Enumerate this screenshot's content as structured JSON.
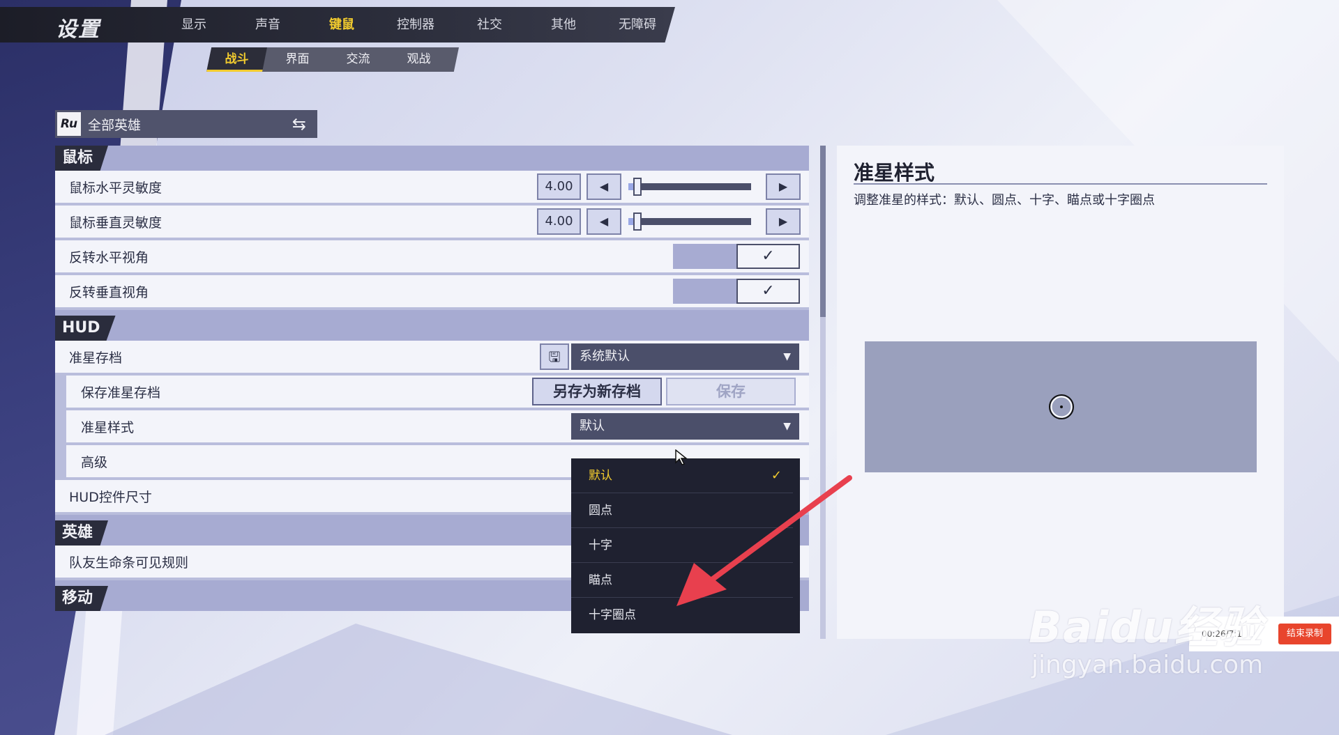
{
  "header": {
    "title": "设置",
    "tabs": [
      {
        "label": "显示"
      },
      {
        "label": "声音"
      },
      {
        "label": "键鼠",
        "active": true
      },
      {
        "label": "控制器"
      },
      {
        "label": "社交"
      },
      {
        "label": "其他"
      },
      {
        "label": "无障碍"
      }
    ]
  },
  "subtabs": [
    {
      "label": "战斗",
      "active": true
    },
    {
      "label": "界面"
    },
    {
      "label": "交流"
    },
    {
      "label": "观战"
    }
  ],
  "hero_selector": {
    "label": "全部英雄",
    "logo_text": "Ru",
    "swap_icon": "⇆"
  },
  "sections": {
    "mouse": {
      "title": "鼠标",
      "h_sensitivity": {
        "label": "鼠标水平灵敏度",
        "value": "4.00",
        "level": 0.04
      },
      "v_sensitivity": {
        "label": "鼠标垂直灵敏度",
        "value": "4.00",
        "level": 0.04
      },
      "invert_h": {
        "label": "反转水平视角",
        "checked": true
      },
      "invert_v": {
        "label": "反转垂直视角",
        "checked": true
      }
    },
    "hud": {
      "title": "HUD",
      "crosshair_profile": {
        "label": "准星存档",
        "value": "系统默认"
      },
      "save_profile": {
        "label": "保存准星存档",
        "save_new": "另存为新存档",
        "save": "保存"
      },
      "crosshair_style": {
        "label": "准星样式",
        "value": "默认"
      },
      "advanced": {
        "label": "高级"
      },
      "hud_size": {
        "label": "HUD控件尺寸"
      }
    },
    "hero": {
      "title": "英雄",
      "teammate_health": {
        "label": "队友生命条可见规则"
      }
    },
    "movement": {
      "title": "移动"
    }
  },
  "style_menu": {
    "options": [
      {
        "label": "默认",
        "selected": true
      },
      {
        "label": "圆点"
      },
      {
        "label": "十字"
      },
      {
        "label": "瞄点"
      },
      {
        "label": "十字圈点"
      }
    ],
    "check": "✓"
  },
  "detail": {
    "title": "准星样式",
    "description": "调整准星的样式：默认、圆点、十字、瞄点或十字圈点"
  },
  "recorder": {
    "time": "00:26/7:1",
    "stop_label": "结束录制"
  },
  "watermark": {
    "main": "Baidu经验",
    "sub": "jingyan.baidu.com"
  },
  "colors": {
    "accent": "#f3cc2e",
    "panel": "#f3f4fa",
    "section": "#a7abd2",
    "dark": "#1f2130",
    "annotation": "#e8404e"
  }
}
